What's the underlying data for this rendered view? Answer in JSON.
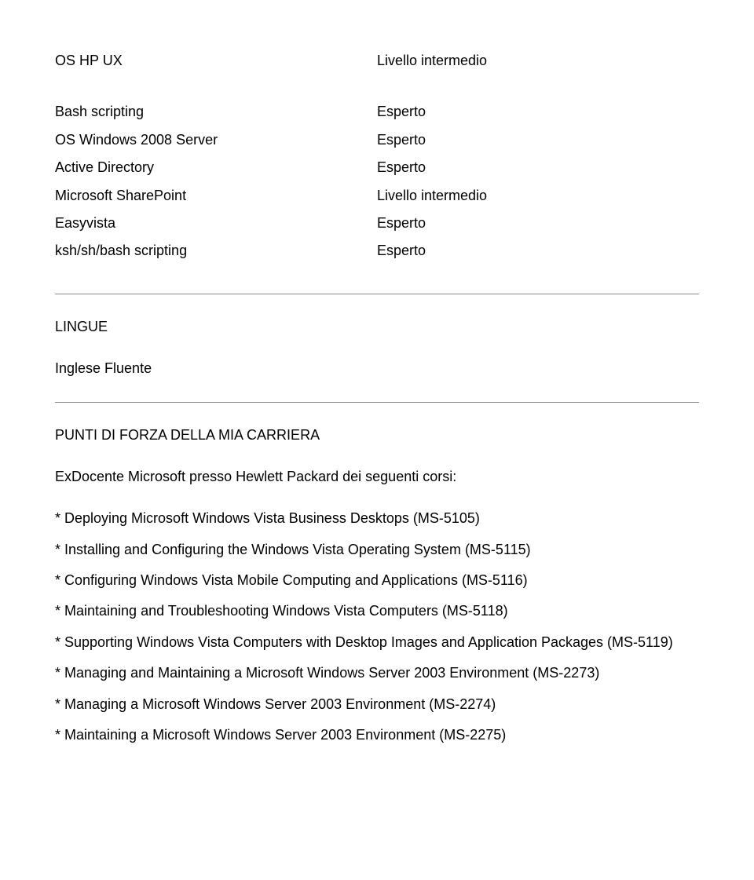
{
  "skills": [
    {
      "name": "OS HP UX",
      "level": "Livello intermedio"
    },
    {
      "name": "Bash scripting",
      "level": "Esperto"
    },
    {
      "name": "OS Windows 2008 Server",
      "level": "Esperto"
    },
    {
      "name": "Active Directory",
      "level": "Esperto"
    },
    {
      "name": "Microsoft SharePoint",
      "level": "Livello intermedio"
    },
    {
      "name": "Easyvista",
      "level": "Esperto"
    },
    {
      "name": "ksh/sh/bash scripting",
      "level": "Esperto"
    }
  ],
  "sections": {
    "languages_title": "LINGUE",
    "language_line": "Inglese Fluente",
    "career_title": "PUNTI DI FORZA DELLA MIA CARRIERA",
    "career_intro": "ExDocente Microsoft presso Hewlett Packard dei seguenti corsi:"
  },
  "courses": [
    "* Deploying Microsoft Windows Vista Business Desktops (MS-5105)",
    "* Installing and Configuring the Windows Vista Operating System (MS-5115)",
    "* Configuring Windows Vista Mobile Computing and Applications (MS-5116)",
    "* Maintaining and Troubleshooting Windows Vista Computers (MS-5118)",
    "* Supporting Windows Vista Computers with Desktop Images and Application Packages (MS-5119)",
    "* Managing and Maintaining a Microsoft Windows Server 2003 Environment (MS-2273)",
    "* Managing a Microsoft Windows Server 2003 Environment (MS-2274)",
    "* Maintaining a Microsoft Windows Server 2003 Environment (MS-2275)"
  ]
}
